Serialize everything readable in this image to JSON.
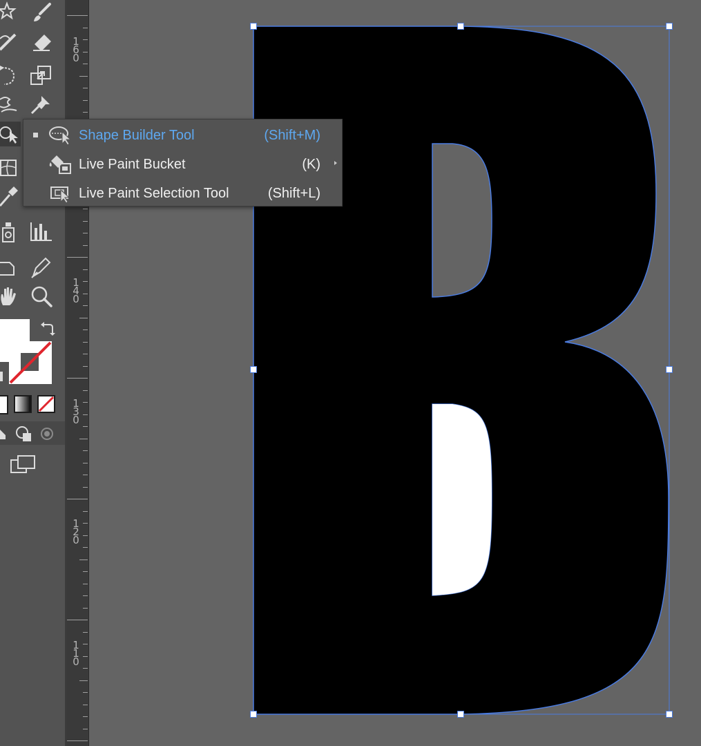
{
  "ruler": {
    "labels": [
      "160",
      "140",
      "130",
      "120",
      "110"
    ]
  },
  "flyout": {
    "items": [
      {
        "label": "Shape Builder Tool",
        "shortcut": "(Shift+M)",
        "icon": "shape-builder-icon",
        "active": true
      },
      {
        "label": "Live Paint Bucket",
        "shortcut": "(K)",
        "icon": "live-paint-bucket-icon",
        "active": false
      },
      {
        "label": "Live Paint Selection Tool",
        "shortcut": "(Shift+L)",
        "icon": "live-paint-selection-icon",
        "active": false
      }
    ]
  },
  "canvas": {
    "letter": "B",
    "letter_color": "#000000",
    "counter_colors": [
      "#646464",
      "#ffffff"
    ],
    "selection_color": "#4a7be0",
    "background": "#646464"
  },
  "colors": {
    "accent": "#5ea8f0",
    "toolbar": "#535353",
    "ruler": "#3a3a3a"
  }
}
